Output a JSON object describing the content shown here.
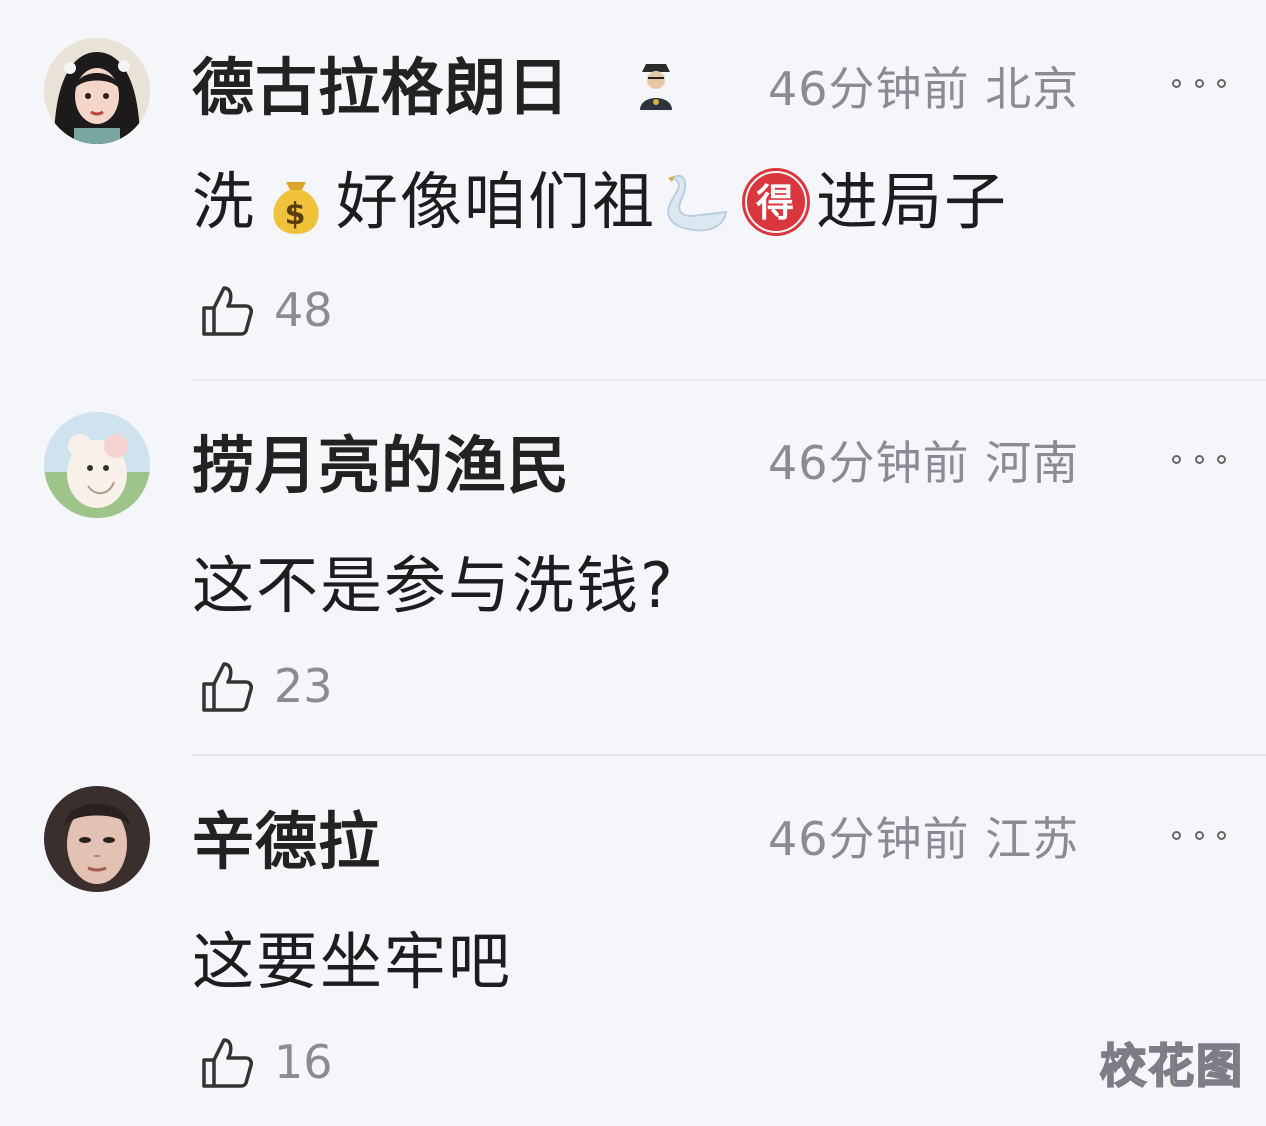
{
  "comments": [
    {
      "username": "德古拉格朗日",
      "time": "46分钟前",
      "location": "北京",
      "text_parts": [
        "洗",
        "好像咱们祖",
        "进局子"
      ],
      "emojis": [
        "money-bag-emoji",
        "swan-emoji",
        "de-character-emoji"
      ],
      "likes": "48",
      "avatar": "anime-girl-avatar",
      "badge": "detective-badge-icon"
    },
    {
      "username": "捞月亮的渔民",
      "time": "46分钟前",
      "location": "河南",
      "text": "这不是参与洗钱?",
      "likes": "23",
      "avatar": "cartoon-bear-avatar"
    },
    {
      "username": "辛德拉",
      "time": "46分钟前",
      "location": "江苏",
      "text": "这要坐牢吧",
      "likes": "16",
      "avatar": "face-photo-avatar"
    }
  ],
  "watermark": "校花图",
  "colors": {
    "background": "#f5f6fa",
    "meta_text": "#8b8b93",
    "divider": "#e8e9ef"
  }
}
